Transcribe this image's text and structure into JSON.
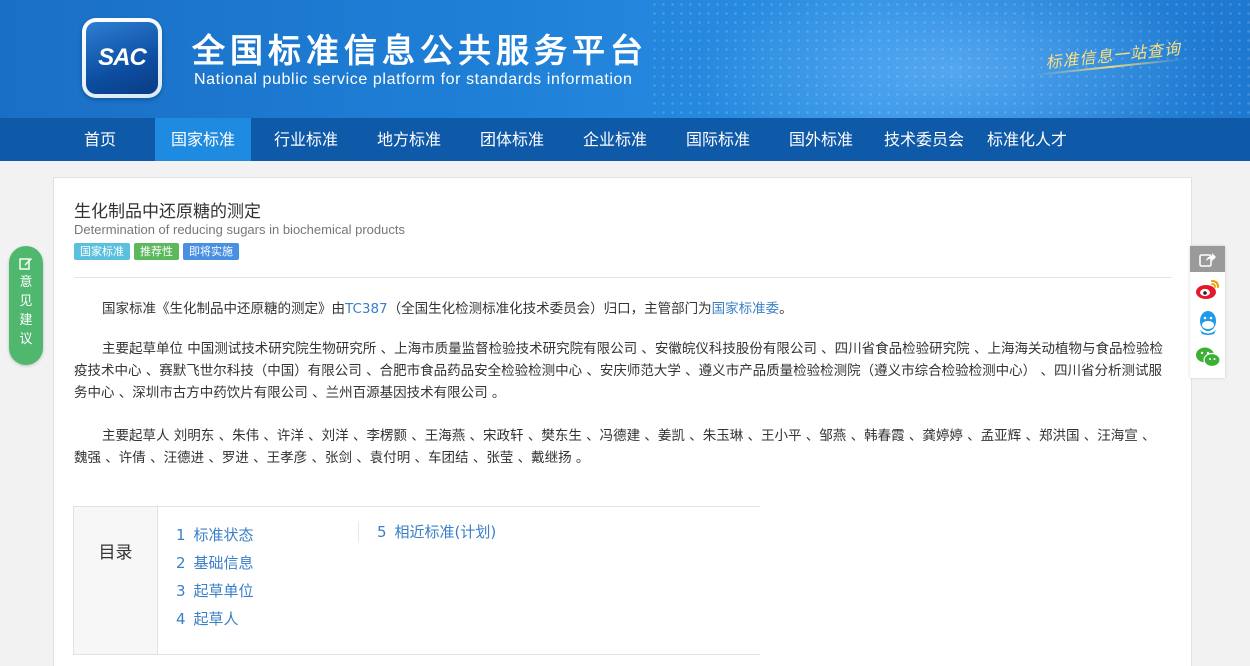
{
  "header": {
    "logo_text": "SAC",
    "title": "全国标准信息公共服务平台",
    "subtitle": "National public service platform  for standards information",
    "slogan": "标准信息一站查询"
  },
  "nav": {
    "items": [
      {
        "label": "首页",
        "active": false
      },
      {
        "label": "国家标准",
        "active": true
      },
      {
        "label": "行业标准",
        "active": false
      },
      {
        "label": "地方标准",
        "active": false
      },
      {
        "label": "团体标准",
        "active": false
      },
      {
        "label": "企业标准",
        "active": false
      },
      {
        "label": "国际标准",
        "active": false
      },
      {
        "label": "国外标准",
        "active": false
      },
      {
        "label": "技术委员会",
        "active": false
      },
      {
        "label": "标准化人才",
        "active": false
      }
    ]
  },
  "standard": {
    "title_cn": "生化制品中还原糖的测定",
    "title_en": "Determination of reducing sugars in biochemical products",
    "badges": [
      "国家标准",
      "推荐性",
      "即将实施"
    ]
  },
  "intro": {
    "p1_prefix": "国家标准《生化制品中还原糖的测定》由",
    "p1_tc_link": "TC387",
    "p1_middle": "（全国生化检测标准化技术委员会）归口，主管部门为",
    "p1_dept_link": "国家标准委",
    "p1_suffix": "。",
    "p2": "主要起草单位 中国测试技术研究院生物研究所 、上海市质量监督检验技术研究院有限公司 、安徽皖仪科技股份有限公司 、四川省食品检验研究院 、上海海关动植物与食品检验检疫技术中心 、赛默飞世尔科技（中国）有限公司 、合肥市食品药品安全检验检测中心 、安庆师范大学 、遵义市产品质量检验检测院（遵义市综合检验检测中心） 、四川省分析测试服务中心 、深圳市古方中药饮片有限公司 、兰州百源基因技术有限公司 。",
    "p3": "主要起草人 刘明东 、朱伟 、许洋 、刘洋 、李楞颢 、王海燕 、宋政轩 、樊东生 、冯德建 、姜凯 、朱玉琳 、王小平 、邹燕 、韩春霞 、龚婷婷 、孟亚辉 、郑洪国 、汪海宣 、魏强 、许倩 、汪德进 、罗进 、王孝彦 、张剑 、袁付明 、车团结 、张莹 、戴继扬 。"
  },
  "toc": {
    "label": "目录",
    "items": [
      {
        "num": "1",
        "label": "标准状态"
      },
      {
        "num": "2",
        "label": "基础信息"
      },
      {
        "num": "3",
        "label": "起草单位"
      },
      {
        "num": "4",
        "label": "起草人"
      },
      {
        "num": "5",
        "label": "相近标准(计划)"
      }
    ]
  },
  "feedback": {
    "label": "意见建议",
    "icon": "edit-icon"
  },
  "share": {
    "icons": [
      "share-icon",
      "weibo-icon",
      "qq-icon",
      "wechat-icon"
    ]
  },
  "colors": {
    "nav_bg": "#0f5aa8",
    "nav_active": "#1f8be0",
    "link": "#3a7fc8",
    "feedback_bg": "#4fb86e",
    "badge_national": "#5bc0de",
    "badge_recommended": "#5cb85c",
    "badge_upcoming": "#4a90e2"
  }
}
